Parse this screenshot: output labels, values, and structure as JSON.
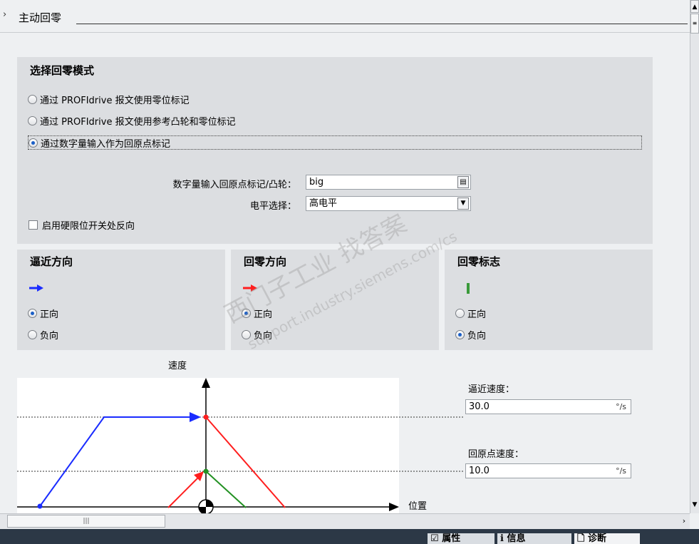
{
  "header": {
    "title": "主动回零"
  },
  "mode": {
    "title": "选择回零模式",
    "options": [
      "通过 PROFIdrive 报文使用零位标记",
      "通过 PROFIdrive 报文使用参考凸轮和零位标记",
      "通过数字量输入作为回原点标记"
    ],
    "selected_index": 2,
    "input_label": "数字量输入回原点标记/凸轮：",
    "input_value": "big",
    "level_label": "电平选择：",
    "level_value": "高电平",
    "checkbox_label": "启用硬限位开关处反向",
    "checkbox_checked": false
  },
  "approach_dir": {
    "title": "逼近方向",
    "arrow_color": "#1a2cff",
    "opt_pos": "正向",
    "opt_neg": "负向",
    "selected": "正向"
  },
  "home_dir": {
    "title": "回零方向",
    "arrow_color": "#ff1e1e",
    "opt_pos": "正向",
    "opt_neg": "负向",
    "selected": "正向"
  },
  "home_flag": {
    "title": "回零标志",
    "marker_color": "#3a9a3a",
    "opt_pos": "正向",
    "opt_neg": "负向",
    "selected": "负向"
  },
  "diagram": {
    "y_label": "速度",
    "x_label": "位置"
  },
  "speeds": {
    "approach_label": "逼近速度：",
    "approach_value": "30.0",
    "approach_unit": "°/s",
    "home_label": "回原点速度：",
    "home_value": "10.0",
    "home_unit": "°/s"
  },
  "watermark": {
    "line1": "西门子工业   找答案",
    "line2": "support.industry.siemens.com/cs"
  },
  "bottom_tabs": [
    "属性",
    "信息",
    "诊断"
  ]
}
